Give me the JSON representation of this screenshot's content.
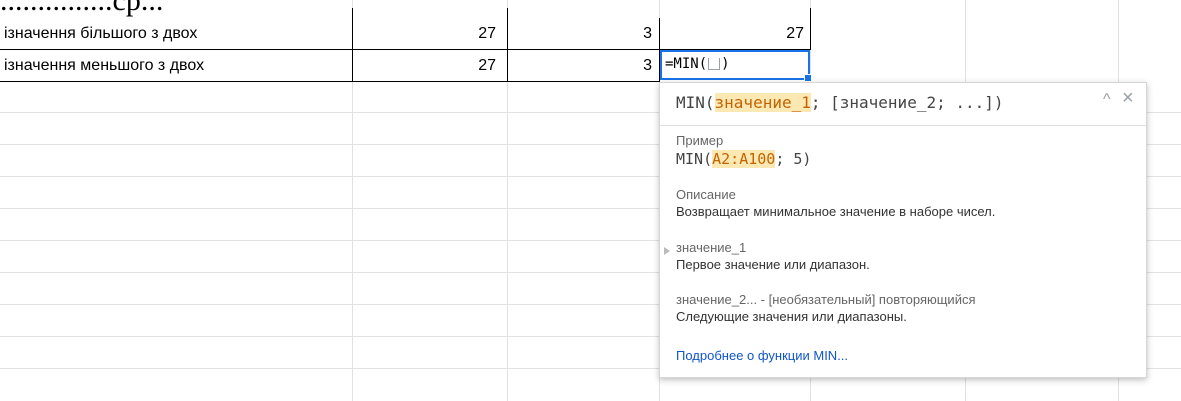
{
  "page_header_fragment": "...............ср...",
  "rows": [
    {
      "label": "ізначення більшого з двох",
      "b": "27",
      "c": "3",
      "d": "27"
    },
    {
      "label": "ізначення меньшого з двох",
      "b": "27",
      "c": "3"
    }
  ],
  "active_cell": {
    "formula_before": "=MIN(",
    "formula_after": ")"
  },
  "tooltip": {
    "signature_start": "MIN(",
    "signature_highlight": "значение_1",
    "signature_end": "; [значение_2; ...])",
    "collapse_glyph": "^",
    "close_glyph": "×",
    "example_label": "Пример",
    "example_start": "MIN(",
    "example_highlight": "A2:A100",
    "example_end": "; 5)",
    "description_label": "Описание",
    "description_text": "Возвращает минимальное значение в наборе чисел.",
    "arg1_name": "значение_1",
    "arg1_desc": "Первое значение или диапазон.",
    "arg2_name": "значение_2... - [необязательный] повторяющийся",
    "arg2_desc": "Следующие значения или диапазоны.",
    "learn_more": "Подробнее о функции MIN..."
  }
}
